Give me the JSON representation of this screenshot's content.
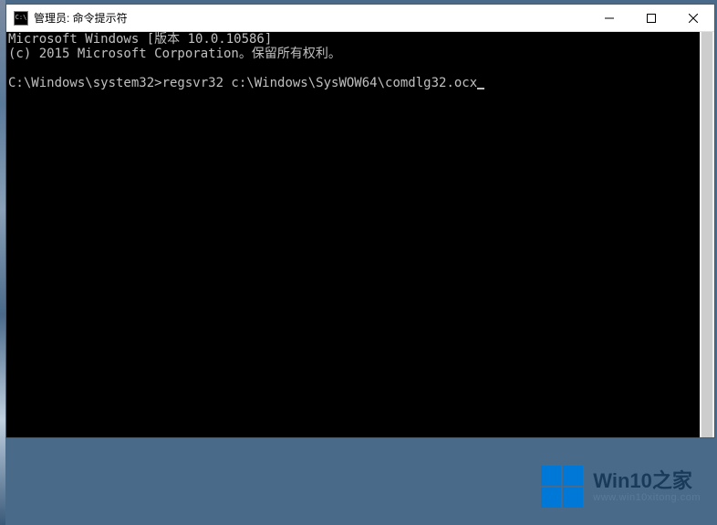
{
  "window": {
    "title": "管理员: 命令提示符"
  },
  "console": {
    "line1": "Microsoft Windows [版本 10.0.10586]",
    "line2": "(c) 2015 Microsoft Corporation。保留所有权利。",
    "blank": "",
    "prompt": "C:\\Windows\\system32>",
    "command": "regsvr32 c:\\Windows\\SysWOW64\\comdlg32.ocx"
  },
  "watermark": {
    "title": "Win10之家",
    "url": "www.win10xitong.com"
  }
}
